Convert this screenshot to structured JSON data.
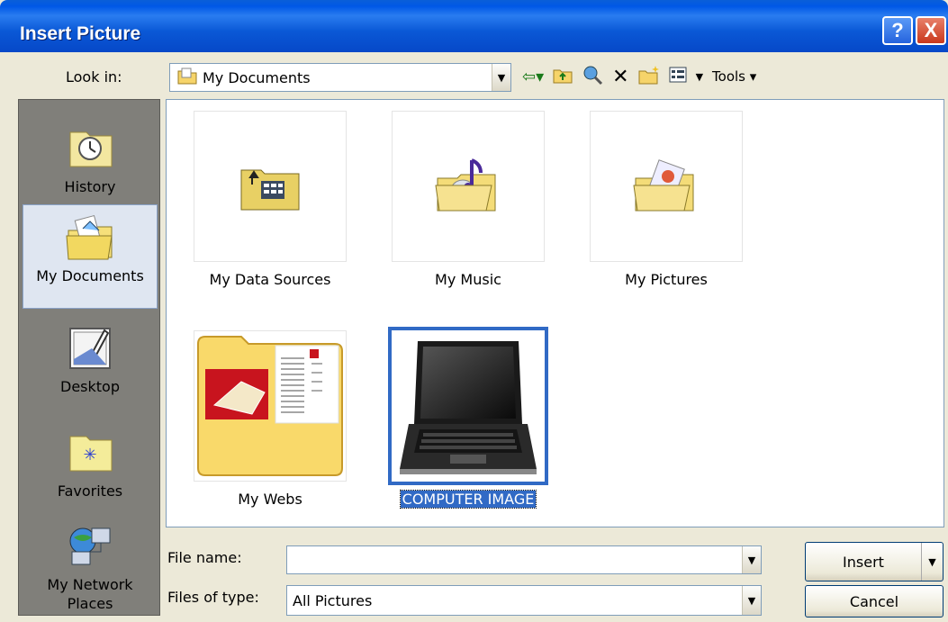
{
  "window": {
    "title": "Insert Picture",
    "help_label": "?",
    "close_label": "X"
  },
  "toolbar": {
    "look_in_label": "Look in:",
    "look_in_value": "My Documents",
    "tools_label": "Tools",
    "icons": [
      "back-arrow-icon",
      "up-folder-icon",
      "search-web-icon",
      "delete-icon",
      "new-folder-icon",
      "views-icon"
    ]
  },
  "places": [
    {
      "label": "History",
      "icon": "history-icon"
    },
    {
      "label": "My Documents",
      "icon": "my-documents-icon",
      "selected": true
    },
    {
      "label": "Desktop",
      "icon": "desktop-icon"
    },
    {
      "label": "Favorites",
      "icon": "favorites-icon"
    },
    {
      "label": "My Network Places",
      "icon": "network-places-icon"
    }
  ],
  "files": [
    {
      "label": "My Data Sources",
      "type": "folder"
    },
    {
      "label": "My Music",
      "type": "folder"
    },
    {
      "label": "My Pictures",
      "type": "folder"
    },
    {
      "label": "My Webs",
      "type": "folder"
    },
    {
      "label": "COMPUTER IMAGE",
      "type": "image",
      "selected": true
    }
  ],
  "file_name": {
    "label": "File name:",
    "value": ""
  },
  "file_type": {
    "label": "Files of type:",
    "value": "All Pictures"
  },
  "buttons": {
    "insert": "Insert",
    "cancel": "Cancel"
  }
}
